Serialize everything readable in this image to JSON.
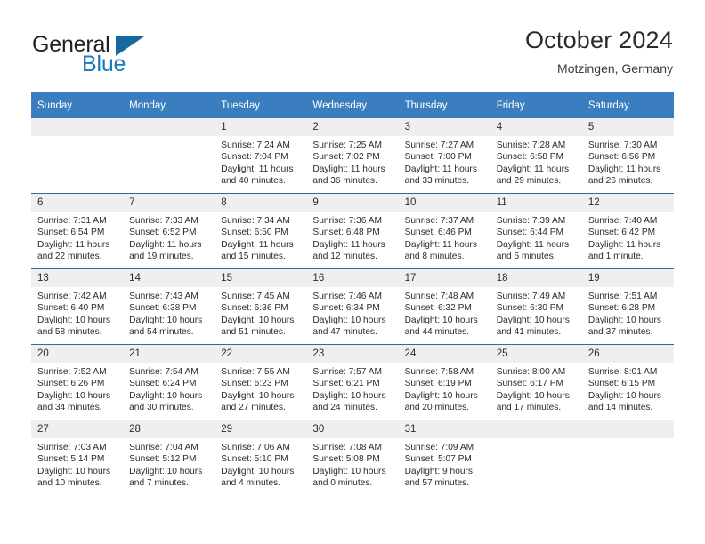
{
  "brand": {
    "name_top": "General",
    "name_bottom": "Blue"
  },
  "header": {
    "title": "October 2024",
    "subtitle": "Motzingen, Germany"
  },
  "colors": {
    "header_blue": "#3a7ebf",
    "row_divider": "#2c6ca5",
    "daynum_band": "#efefef",
    "logo_blue": "#1878be"
  },
  "weekday_headers": [
    "Sunday",
    "Monday",
    "Tuesday",
    "Wednesday",
    "Thursday",
    "Friday",
    "Saturday"
  ],
  "weeks": [
    [
      {
        "day": "",
        "sunrise": "",
        "sunset": "",
        "daylight": ""
      },
      {
        "day": "",
        "sunrise": "",
        "sunset": "",
        "daylight": ""
      },
      {
        "day": "1",
        "sunrise": "Sunrise: 7:24 AM",
        "sunset": "Sunset: 7:04 PM",
        "daylight": "Daylight: 11 hours and 40 minutes."
      },
      {
        "day": "2",
        "sunrise": "Sunrise: 7:25 AM",
        "sunset": "Sunset: 7:02 PM",
        "daylight": "Daylight: 11 hours and 36 minutes."
      },
      {
        "day": "3",
        "sunrise": "Sunrise: 7:27 AM",
        "sunset": "Sunset: 7:00 PM",
        "daylight": "Daylight: 11 hours and 33 minutes."
      },
      {
        "day": "4",
        "sunrise": "Sunrise: 7:28 AM",
        "sunset": "Sunset: 6:58 PM",
        "daylight": "Daylight: 11 hours and 29 minutes."
      },
      {
        "day": "5",
        "sunrise": "Sunrise: 7:30 AM",
        "sunset": "Sunset: 6:56 PM",
        "daylight": "Daylight: 11 hours and 26 minutes."
      }
    ],
    [
      {
        "day": "6",
        "sunrise": "Sunrise: 7:31 AM",
        "sunset": "Sunset: 6:54 PM",
        "daylight": "Daylight: 11 hours and 22 minutes."
      },
      {
        "day": "7",
        "sunrise": "Sunrise: 7:33 AM",
        "sunset": "Sunset: 6:52 PM",
        "daylight": "Daylight: 11 hours and 19 minutes."
      },
      {
        "day": "8",
        "sunrise": "Sunrise: 7:34 AM",
        "sunset": "Sunset: 6:50 PM",
        "daylight": "Daylight: 11 hours and 15 minutes."
      },
      {
        "day": "9",
        "sunrise": "Sunrise: 7:36 AM",
        "sunset": "Sunset: 6:48 PM",
        "daylight": "Daylight: 11 hours and 12 minutes."
      },
      {
        "day": "10",
        "sunrise": "Sunrise: 7:37 AM",
        "sunset": "Sunset: 6:46 PM",
        "daylight": "Daylight: 11 hours and 8 minutes."
      },
      {
        "day": "11",
        "sunrise": "Sunrise: 7:39 AM",
        "sunset": "Sunset: 6:44 PM",
        "daylight": "Daylight: 11 hours and 5 minutes."
      },
      {
        "day": "12",
        "sunrise": "Sunrise: 7:40 AM",
        "sunset": "Sunset: 6:42 PM",
        "daylight": "Daylight: 11 hours and 1 minute."
      }
    ],
    [
      {
        "day": "13",
        "sunrise": "Sunrise: 7:42 AM",
        "sunset": "Sunset: 6:40 PM",
        "daylight": "Daylight: 10 hours and 58 minutes."
      },
      {
        "day": "14",
        "sunrise": "Sunrise: 7:43 AM",
        "sunset": "Sunset: 6:38 PM",
        "daylight": "Daylight: 10 hours and 54 minutes."
      },
      {
        "day": "15",
        "sunrise": "Sunrise: 7:45 AM",
        "sunset": "Sunset: 6:36 PM",
        "daylight": "Daylight: 10 hours and 51 minutes."
      },
      {
        "day": "16",
        "sunrise": "Sunrise: 7:46 AM",
        "sunset": "Sunset: 6:34 PM",
        "daylight": "Daylight: 10 hours and 47 minutes."
      },
      {
        "day": "17",
        "sunrise": "Sunrise: 7:48 AM",
        "sunset": "Sunset: 6:32 PM",
        "daylight": "Daylight: 10 hours and 44 minutes."
      },
      {
        "day": "18",
        "sunrise": "Sunrise: 7:49 AM",
        "sunset": "Sunset: 6:30 PM",
        "daylight": "Daylight: 10 hours and 41 minutes."
      },
      {
        "day": "19",
        "sunrise": "Sunrise: 7:51 AM",
        "sunset": "Sunset: 6:28 PM",
        "daylight": "Daylight: 10 hours and 37 minutes."
      }
    ],
    [
      {
        "day": "20",
        "sunrise": "Sunrise: 7:52 AM",
        "sunset": "Sunset: 6:26 PM",
        "daylight": "Daylight: 10 hours and 34 minutes."
      },
      {
        "day": "21",
        "sunrise": "Sunrise: 7:54 AM",
        "sunset": "Sunset: 6:24 PM",
        "daylight": "Daylight: 10 hours and 30 minutes."
      },
      {
        "day": "22",
        "sunrise": "Sunrise: 7:55 AM",
        "sunset": "Sunset: 6:23 PM",
        "daylight": "Daylight: 10 hours and 27 minutes."
      },
      {
        "day": "23",
        "sunrise": "Sunrise: 7:57 AM",
        "sunset": "Sunset: 6:21 PM",
        "daylight": "Daylight: 10 hours and 24 minutes."
      },
      {
        "day": "24",
        "sunrise": "Sunrise: 7:58 AM",
        "sunset": "Sunset: 6:19 PM",
        "daylight": "Daylight: 10 hours and 20 minutes."
      },
      {
        "day": "25",
        "sunrise": "Sunrise: 8:00 AM",
        "sunset": "Sunset: 6:17 PM",
        "daylight": "Daylight: 10 hours and 17 minutes."
      },
      {
        "day": "26",
        "sunrise": "Sunrise: 8:01 AM",
        "sunset": "Sunset: 6:15 PM",
        "daylight": "Daylight: 10 hours and 14 minutes."
      }
    ],
    [
      {
        "day": "27",
        "sunrise": "Sunrise: 7:03 AM",
        "sunset": "Sunset: 5:14 PM",
        "daylight": "Daylight: 10 hours and 10 minutes."
      },
      {
        "day": "28",
        "sunrise": "Sunrise: 7:04 AM",
        "sunset": "Sunset: 5:12 PM",
        "daylight": "Daylight: 10 hours and 7 minutes."
      },
      {
        "day": "29",
        "sunrise": "Sunrise: 7:06 AM",
        "sunset": "Sunset: 5:10 PM",
        "daylight": "Daylight: 10 hours and 4 minutes."
      },
      {
        "day": "30",
        "sunrise": "Sunrise: 7:08 AM",
        "sunset": "Sunset: 5:08 PM",
        "daylight": "Daylight: 10 hours and 0 minutes."
      },
      {
        "day": "31",
        "sunrise": "Sunrise: 7:09 AM",
        "sunset": "Sunset: 5:07 PM",
        "daylight": "Daylight: 9 hours and 57 minutes."
      },
      {
        "day": "",
        "sunrise": "",
        "sunset": "",
        "daylight": ""
      },
      {
        "day": "",
        "sunrise": "",
        "sunset": "",
        "daylight": ""
      }
    ]
  ]
}
